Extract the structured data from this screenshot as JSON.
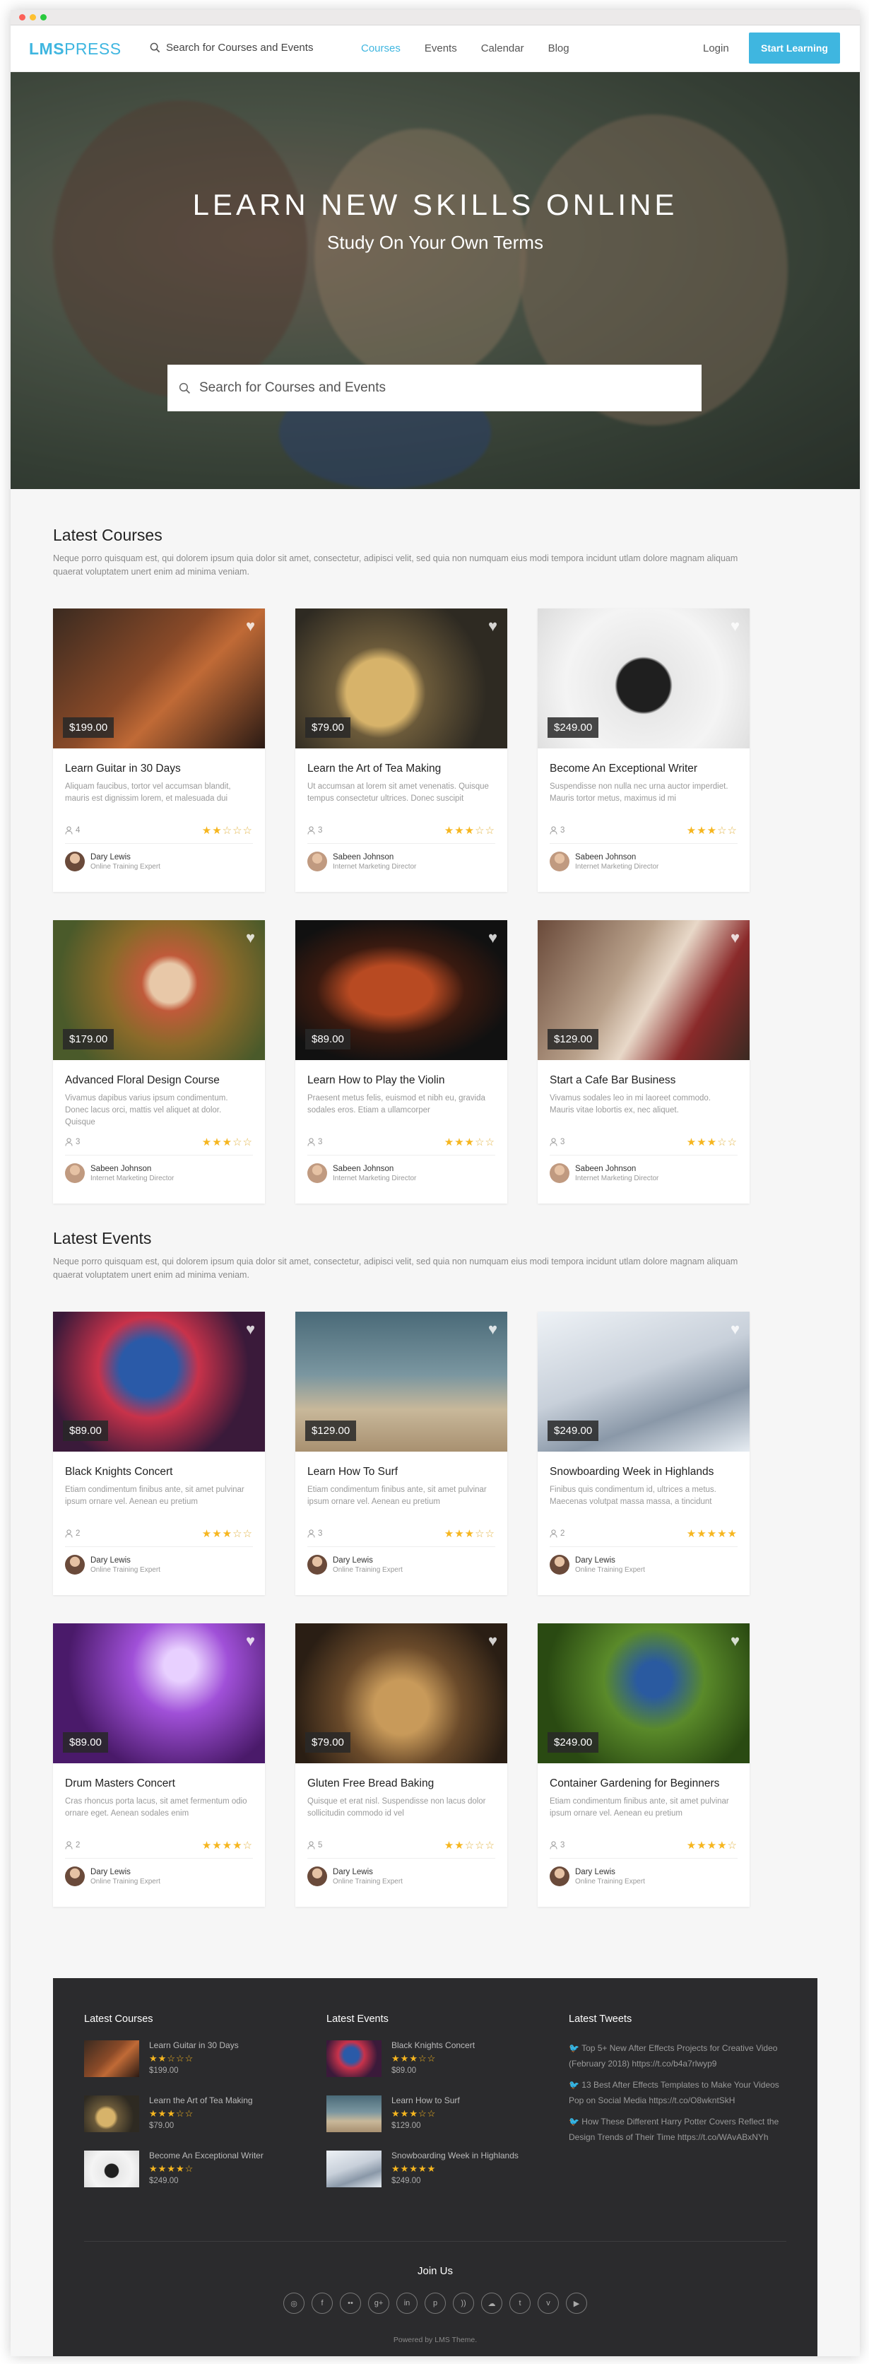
{
  "nav": {
    "logo_bold": "LMS",
    "logo_light": "PRESS",
    "search_placeholder": "Search for Courses and Events",
    "links": [
      "Courses",
      "Events",
      "Calendar",
      "Blog"
    ],
    "login": "Login",
    "cta": "Start Learning"
  },
  "hero": {
    "title": "LEARN NEW SKILLS ONLINE",
    "subtitle": "Study On Your Own Terms",
    "search_placeholder": "Search for Courses and Events"
  },
  "courses": {
    "title": "Latest Courses",
    "description": "Neque porro quisquam est, qui dolorem ipsum quia dolor sit amet, consectetur, adipisci velit, sed quia non numquam eius modi tempora incidunt utlam dolore magnam aliquam quaerat voluptatem unert enim ad minima veniam.",
    "items": [
      {
        "price": "$199.00",
        "title": "Learn Guitar in 30 Days",
        "desc": "Aliquam faucibus, tortor vel accumsan blandit, mauris est dignissim lorem, et malesuada dui",
        "students": "4",
        "rating": 2,
        "author": "Dary Lewis",
        "role": "Online Training Expert"
      },
      {
        "price": "$79.00",
        "title": "Learn the Art of Tea Making",
        "desc": "Ut accumsan at lorem sit amet venenatis. Quisque tempus consectetur ultrices. Donec suscipit",
        "students": "3",
        "rating": 3,
        "author": "Sabeen Johnson",
        "role": "Internet Marketing Director"
      },
      {
        "price": "$249.00",
        "title": "Become An Exceptional Writer",
        "desc": "Suspendisse non nulla nec urna auctor imperdiet. Mauris tortor metus, maximus id mi",
        "students": "3",
        "rating": 3,
        "author": "Sabeen Johnson",
        "role": "Internet Marketing Director"
      },
      {
        "price": "$179.00",
        "title": "Advanced Floral Design Course",
        "desc": "Vivamus dapibus varius ipsum condimentum. Donec lacus orci, mattis vel aliquet at dolor. Quisque",
        "students": "3",
        "rating": 3,
        "author": "Sabeen Johnson",
        "role": "Internet Marketing Director"
      },
      {
        "price": "$89.00",
        "title": "Learn How to Play the Violin",
        "desc": "Praesent metus felis, euismod et nibh eu, gravida sodales eros. Etiam a ullamcorper",
        "students": "3",
        "rating": 3,
        "author": "Sabeen Johnson",
        "role": "Internet Marketing Director"
      },
      {
        "price": "$129.00",
        "title": "Start a Cafe Bar Business",
        "desc": "Vivamus sodales leo in mi laoreet commodo. Mauris vitae lobortis ex, nec aliquet.",
        "students": "3",
        "rating": 3,
        "author": "Sabeen Johnson",
        "role": "Internet Marketing Director"
      }
    ]
  },
  "events": {
    "title": "Latest Events",
    "description": "Neque porro quisquam est, qui dolorem ipsum quia dolor sit amet, consectetur, adipisci velit, sed quia non numquam eius modi tempora incidunt utlam dolore magnam aliquam quaerat voluptatem unert enim ad minima veniam.",
    "items": [
      {
        "price": "$89.00",
        "title": "Black Knights Concert",
        "desc": "Etiam condimentum finibus ante, sit amet pulvinar ipsum ornare vel. Aenean eu pretium",
        "students": "2",
        "rating": 3,
        "author": "Dary Lewis",
        "role": "Online Training Expert"
      },
      {
        "price": "$129.00",
        "title": "Learn How To Surf",
        "desc": "Etiam condimentum finibus ante, sit amet pulvinar ipsum ornare vel. Aenean eu pretium",
        "students": "3",
        "rating": 3,
        "author": "Dary Lewis",
        "role": "Online Training Expert"
      },
      {
        "price": "$249.00",
        "title": "Snowboarding Week in Highlands",
        "desc": "Finibus quis condimentum id, ultrices a metus. Maecenas volutpat massa massa, a tincidunt",
        "students": "2",
        "rating": 5,
        "author": "Dary Lewis",
        "role": "Online Training Expert"
      },
      {
        "price": "$89.00",
        "title": "Drum Masters Concert",
        "desc": "Cras rhoncus porta lacus, sit amet fermentum odio ornare eget. Aenean sodales enim",
        "students": "2",
        "rating": 4,
        "author": "Dary Lewis",
        "role": "Online Training Expert"
      },
      {
        "price": "$79.00",
        "title": "Gluten Free Bread Baking",
        "desc": "Quisque et erat nisl. Suspendisse non lacus dolor sollicitudin commodo id vel",
        "students": "5",
        "rating": 2,
        "author": "Dary Lewis",
        "role": "Online Training Expert"
      },
      {
        "price": "$249.00",
        "title": "Container Gardening for Beginners",
        "desc": "Etiam condimentum finibus ante, sit amet pulvinar ipsum ornare vel. Aenean eu pretium",
        "students": "3",
        "rating": 4,
        "author": "Dary Lewis",
        "role": "Online Training Expert"
      }
    ]
  },
  "footer": {
    "courses_title": "Latest Courses",
    "events_title": "Latest Events",
    "tweets_title": "Latest Tweets",
    "courses": [
      {
        "title": "Learn Guitar in 30 Days",
        "rating": 2,
        "price": "$199.00"
      },
      {
        "title": "Learn the Art of Tea Making",
        "rating": 3,
        "price": "$79.00"
      },
      {
        "title": "Become An Exceptional Writer",
        "rating": 4,
        "price": "$249.00"
      }
    ],
    "events": [
      {
        "title": "Black Knights Concert",
        "rating": 3,
        "price": "$89.00"
      },
      {
        "title": "Learn How to Surf",
        "rating": 3,
        "price": "$129.00"
      },
      {
        "title": "Snowboarding Week in Highlands",
        "rating": 5,
        "price": "$249.00"
      }
    ],
    "tweets": [
      "Top 5+ New After Effects Projects for Creative Video (February 2018) https://t.co/b4a7rlwyp9",
      "13 Best After Effects Templates to Make Your Videos Pop on Social Media https://t.co/O8wkntSkH",
      "How These Different Harry Potter Covers Reflect the Design Trends of Their Time https://t.co/WAvABxNYh"
    ],
    "join_us": "Join Us",
    "social_icons": [
      "dribbble-icon",
      "facebook-icon",
      "flickr-icon",
      "google-plus-icon",
      "linkedin-icon",
      "pinterest-icon",
      "rss-icon",
      "soundcloud-icon",
      "twitter-icon",
      "vimeo-icon",
      "youtube-icon"
    ],
    "powered": "Powered by LMS Theme."
  },
  "colors": {
    "accent": "#3fb6e0",
    "star": "#f6b61f",
    "footer_bg": "#2b2b2d"
  }
}
